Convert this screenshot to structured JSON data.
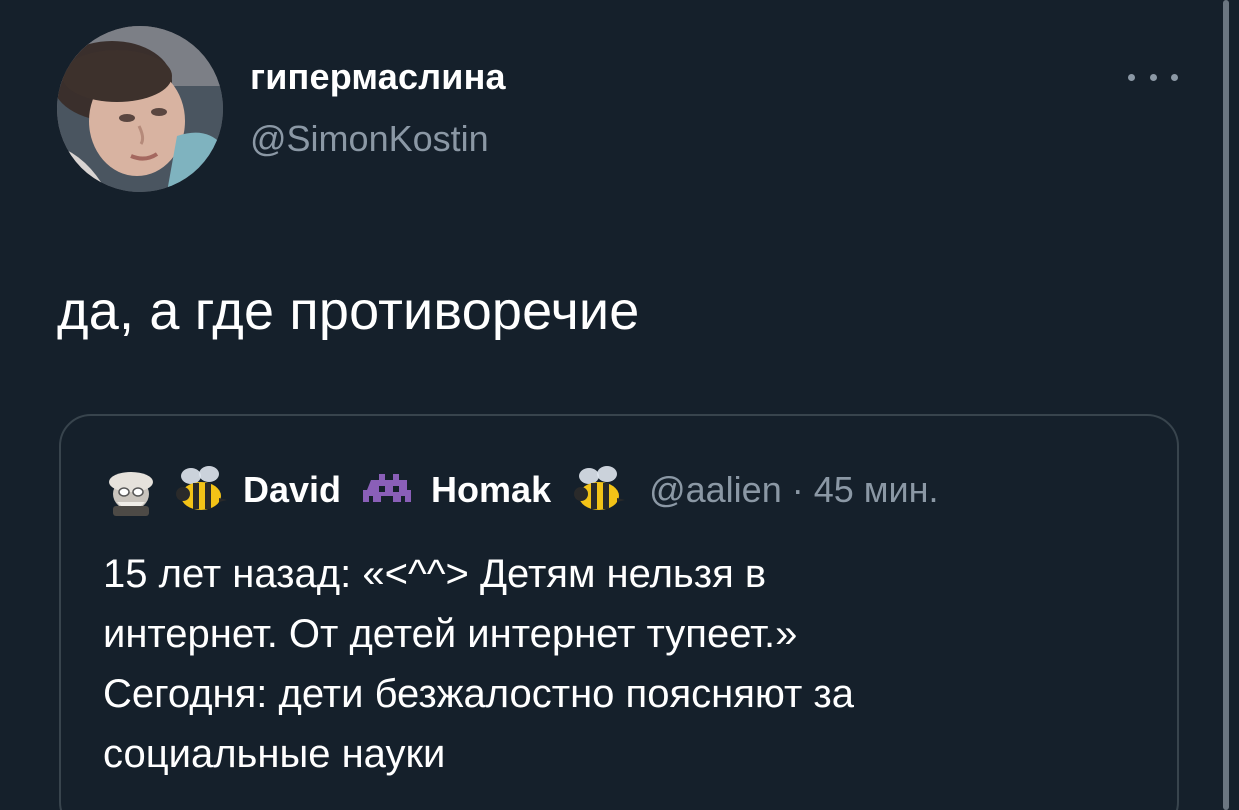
{
  "tweet": {
    "display_name": "гипермаслина",
    "handle": "@SimonKostin",
    "text": "да, а где противоречие",
    "more_icon": "more-horizontal-icon"
  },
  "quoted_tweet": {
    "name_part1": "David",
    "name_part2": "Homak",
    "handle_time": "@aalien · 45 мин.",
    "emojis": [
      "old-man-emoji-icon",
      "bee-emoji-icon",
      "alien-monster-emoji-icon",
      "bee-emoji-icon"
    ],
    "text": "15 лет назад: «<^^> Детям нельзя в\nинтернет. От детей интернет тупеет.»\nСегодня: дети безжалостно поясняют за\nсоциальные науки"
  },
  "colors": {
    "background": "#15202b",
    "secondary_text": "#8b98a5",
    "border": "#38444d"
  }
}
